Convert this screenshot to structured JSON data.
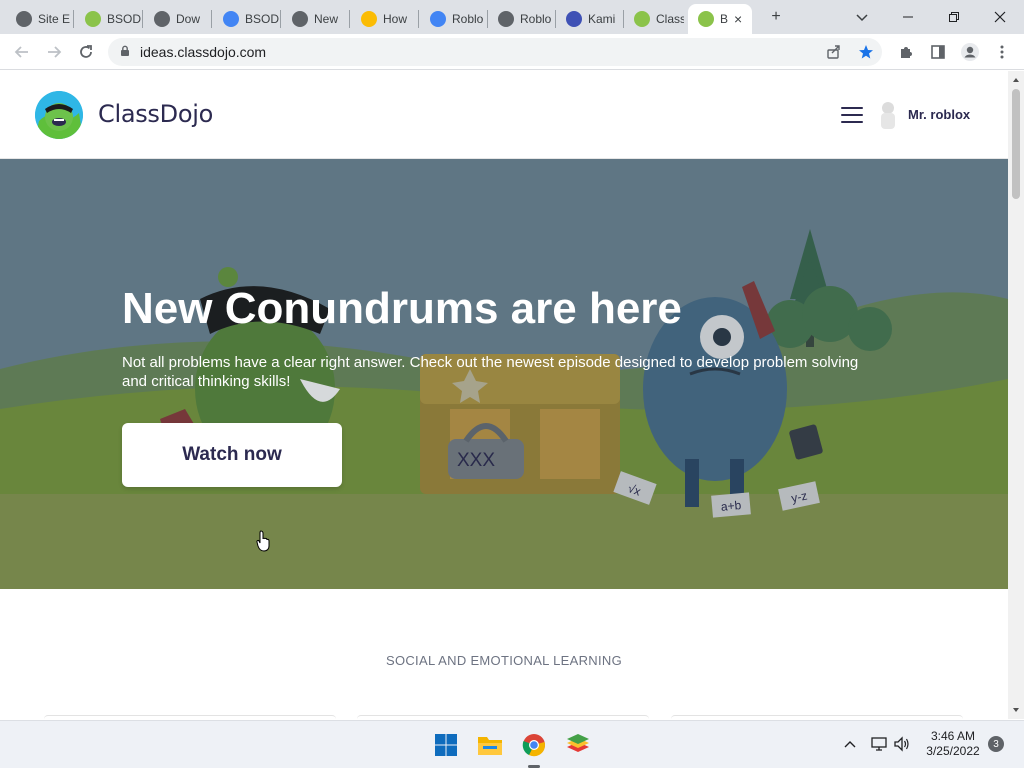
{
  "browser": {
    "tabs": [
      {
        "label": "Site E",
        "icon": "globe-icon",
        "color": "#5f6368"
      },
      {
        "label": "BSOD",
        "icon": "bsod-favicon",
        "color": "#8bc34a"
      },
      {
        "label": "Dow",
        "icon": "globe-icon",
        "color": "#5f6368"
      },
      {
        "label": "BSOD",
        "icon": "play-store-icon",
        "color": "#4285f4"
      },
      {
        "label": "New",
        "icon": "chrome-icon",
        "color": "#5f6368"
      },
      {
        "label": "How",
        "icon": "how-favicon",
        "color": "#fbbc04"
      },
      {
        "label": "Roblo",
        "icon": "play-store-icon",
        "color": "#4285f4"
      },
      {
        "label": "Roblo",
        "icon": "roblox-icon",
        "color": "#5f6368"
      },
      {
        "label": "Kami",
        "icon": "kami-icon",
        "color": "#3f51b5"
      },
      {
        "label": "Class",
        "icon": "classdojo-icon",
        "color": "#8bc34a"
      },
      {
        "label": "B",
        "icon": "classdojo-icon",
        "color": "#8bc34a"
      }
    ],
    "new_tab_symbol": "+",
    "close_symbol": "×",
    "url": "ideas.classdojo.com"
  },
  "site": {
    "brand": "ClassDojo",
    "user_name": "Mr. roblox"
  },
  "hero": {
    "title": "New Conundrums are here",
    "subtitle": "Not all problems have a clear right answer. Check out the newest episode designed to develop problem solving and critical thinking skills!",
    "button_label": "Watch now",
    "chest_label": "XXX",
    "papers": [
      "√x",
      "a+b",
      "y-z"
    ]
  },
  "section": {
    "label": "SOCIAL AND EMOTIONAL LEARNING"
  },
  "taskbar": {
    "apps": [
      "windows-start-icon",
      "file-explorer-icon",
      "chrome-icon",
      "bluestacks-icon"
    ],
    "time": "3:46 AM",
    "date": "3/25/2022",
    "notification_count": "3"
  },
  "colors": {
    "brand_navy": "#2c2a50",
    "hero_sky": "#6e8795",
    "hero_ground": "#7a9a3e"
  }
}
